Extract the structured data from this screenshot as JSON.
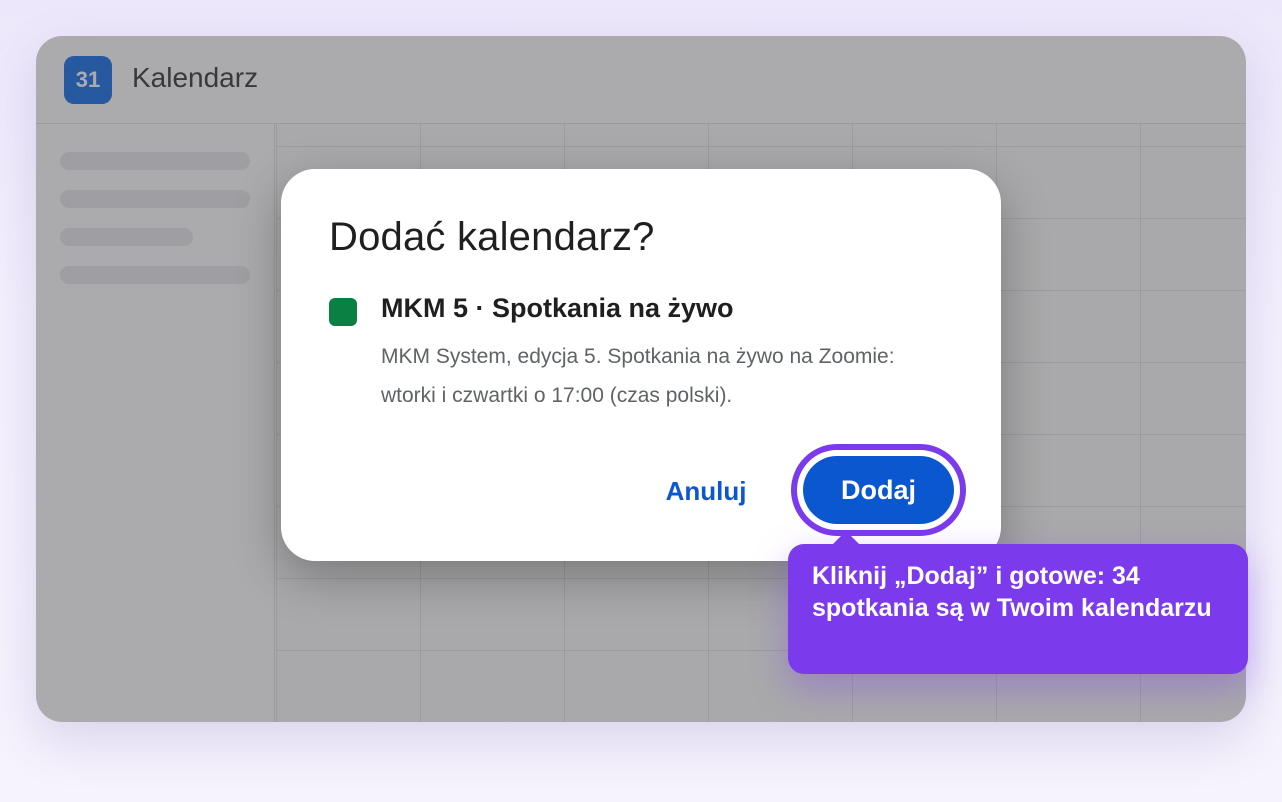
{
  "app": {
    "logo_text": "31",
    "title": "Kalendarz"
  },
  "dialog": {
    "title": "Dodać kalendarz?",
    "calendar": {
      "color": "#0b8043",
      "name": "MKM 5 · Spotkania na żywo",
      "description": "MKM System, edycja 5. Spotkania na żywo na Zoomie: wtorki i czwartki o 17:00 (czas polski)."
    },
    "cancel_label": "Anuluj",
    "add_label": "Dodaj"
  },
  "tooltip": {
    "text": "Kliknij „Dodaj” i gotowe: 34 spotkania są w Twoim kalendarzu"
  },
  "colors": {
    "accent_purple": "#7c3aed",
    "primary_blue": "#0b57d0",
    "logo_blue": "#1a73e8"
  }
}
